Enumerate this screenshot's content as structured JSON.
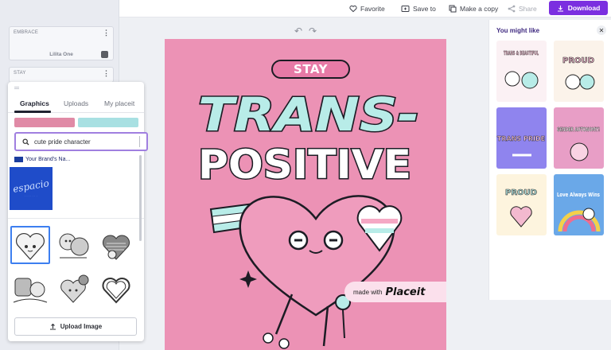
{
  "topbar": {
    "favorite": "Favorite",
    "save_to": "Save to",
    "make_copy": "Make a copy",
    "share": "Share",
    "download": "Download"
  },
  "layers": [
    {
      "label": "EMBRACE",
      "font": "Lilita One"
    },
    {
      "label": "STAY"
    }
  ],
  "panel": {
    "tabs": [
      "Graphics",
      "Uploads",
      "My placeit"
    ],
    "active_tab": "Graphics",
    "search_value": "cute pride character",
    "brand_name": "Your Brand's Na...",
    "brand_logo_text": "espacio",
    "upload_label": "Upload Image",
    "swatch_colors": [
      "#e08aa6",
      "#a8e0e2"
    ]
  },
  "canvas": {
    "stay": "STAY",
    "line1": "TRANS-",
    "line2": "POSITIVE",
    "watermark_prefix": "made with",
    "watermark_brand": "Placeit",
    "background": "#ec92b5"
  },
  "suggestions": {
    "title": "You might like",
    "cards": [
      {
        "text": "TRANS & BEAUTIFUL",
        "bg": "#fbf1f4"
      },
      {
        "text": "PROUD",
        "bg": "#fbf3ea"
      },
      {
        "text": "TRANS PRIDE",
        "bg": "#8f84ee"
      },
      {
        "text": "GENDER AUTONOMY!",
        "bg": "#e89ec6"
      },
      {
        "text": "PROUD",
        "bg": "#fdf4de"
      },
      {
        "text": "Love Always Wins",
        "bg": "#6aa8e8"
      }
    ]
  }
}
